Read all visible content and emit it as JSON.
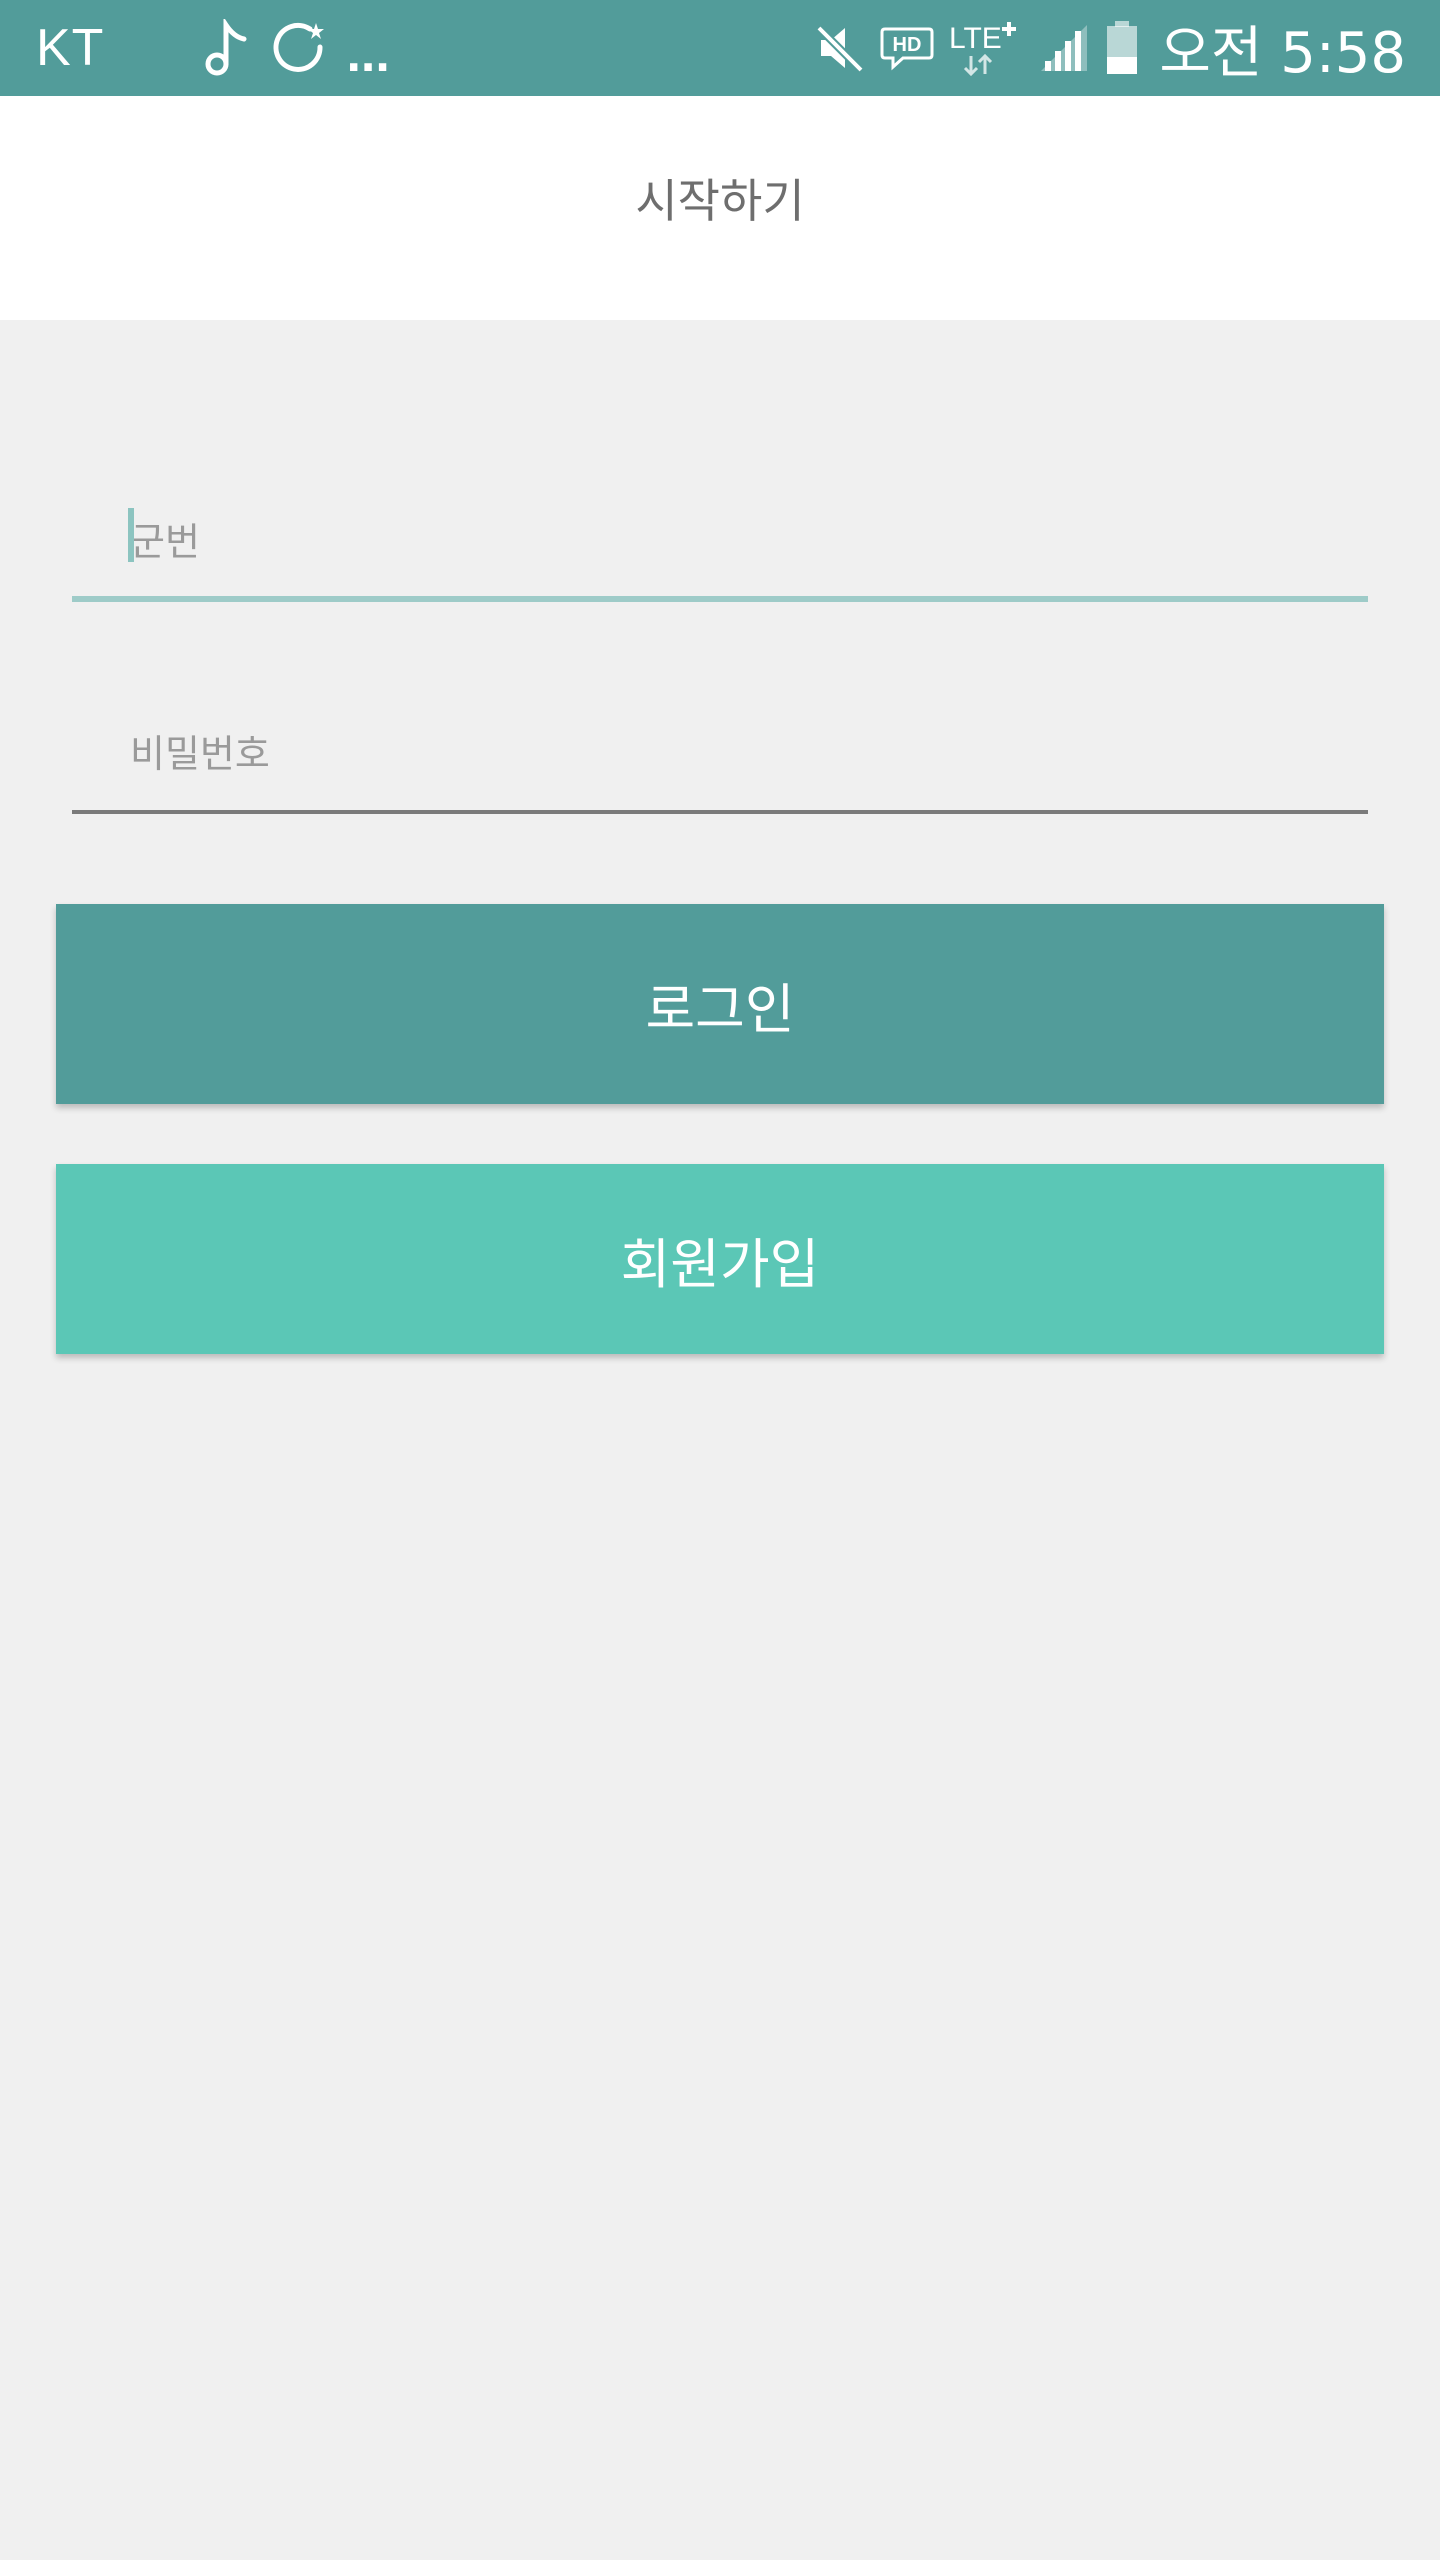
{
  "status_bar": {
    "carrier": "KT",
    "left_icons": [
      "music-note-icon",
      "sync-icon"
    ],
    "more_indicator": "...",
    "right_icons": [
      "mute-icon",
      "hd-voice-icon",
      "lte-plus-icon",
      "signal-icon",
      "battery-icon"
    ],
    "hd_label": "HD",
    "lte_label": "LTE",
    "time": "오전 5:58",
    "colors": {
      "background": "#529c9a",
      "foreground": "#ffffff"
    }
  },
  "app_bar": {
    "title": "시작하기"
  },
  "form": {
    "id_field": {
      "placeholder": "군번",
      "value": "",
      "focused": true
    },
    "password_field": {
      "placeholder": "비밀번호",
      "value": ""
    }
  },
  "buttons": {
    "login_label": "로그인",
    "signup_label": "회원가입"
  },
  "colors": {
    "primary": "#529c9a",
    "accent": "#5bc7b6",
    "focused_underline": "#9ecbc8",
    "page_background": "#f0f0f0"
  }
}
